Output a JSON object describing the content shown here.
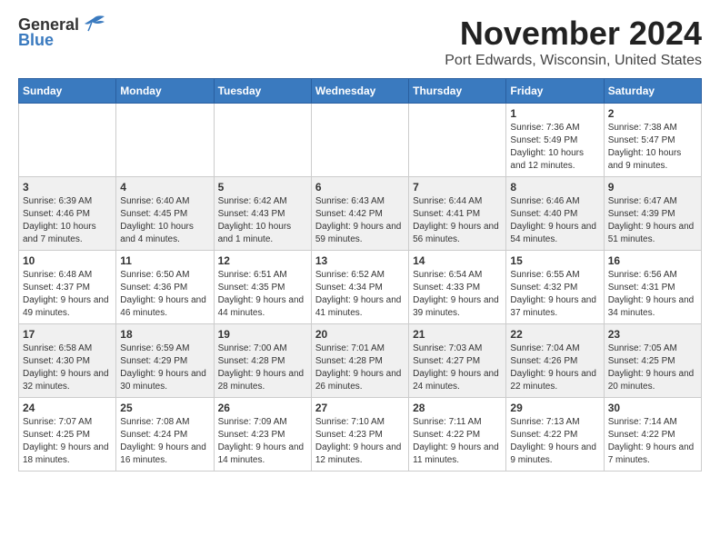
{
  "logo": {
    "general": "General",
    "blue": "Blue"
  },
  "title": "November 2024",
  "location": "Port Edwards, Wisconsin, United States",
  "days_of_week": [
    "Sunday",
    "Monday",
    "Tuesday",
    "Wednesday",
    "Thursday",
    "Friday",
    "Saturday"
  ],
  "weeks": [
    [
      {
        "day": "",
        "info": ""
      },
      {
        "day": "",
        "info": ""
      },
      {
        "day": "",
        "info": ""
      },
      {
        "day": "",
        "info": ""
      },
      {
        "day": "",
        "info": ""
      },
      {
        "day": "1",
        "info": "Sunrise: 7:36 AM\nSunset: 5:49 PM\nDaylight: 10 hours and 12 minutes."
      },
      {
        "day": "2",
        "info": "Sunrise: 7:38 AM\nSunset: 5:47 PM\nDaylight: 10 hours and 9 minutes."
      }
    ],
    [
      {
        "day": "3",
        "info": "Sunrise: 6:39 AM\nSunset: 4:46 PM\nDaylight: 10 hours and 7 minutes."
      },
      {
        "day": "4",
        "info": "Sunrise: 6:40 AM\nSunset: 4:45 PM\nDaylight: 10 hours and 4 minutes."
      },
      {
        "day": "5",
        "info": "Sunrise: 6:42 AM\nSunset: 4:43 PM\nDaylight: 10 hours and 1 minute."
      },
      {
        "day": "6",
        "info": "Sunrise: 6:43 AM\nSunset: 4:42 PM\nDaylight: 9 hours and 59 minutes."
      },
      {
        "day": "7",
        "info": "Sunrise: 6:44 AM\nSunset: 4:41 PM\nDaylight: 9 hours and 56 minutes."
      },
      {
        "day": "8",
        "info": "Sunrise: 6:46 AM\nSunset: 4:40 PM\nDaylight: 9 hours and 54 minutes."
      },
      {
        "day": "9",
        "info": "Sunrise: 6:47 AM\nSunset: 4:39 PM\nDaylight: 9 hours and 51 minutes."
      }
    ],
    [
      {
        "day": "10",
        "info": "Sunrise: 6:48 AM\nSunset: 4:37 PM\nDaylight: 9 hours and 49 minutes."
      },
      {
        "day": "11",
        "info": "Sunrise: 6:50 AM\nSunset: 4:36 PM\nDaylight: 9 hours and 46 minutes."
      },
      {
        "day": "12",
        "info": "Sunrise: 6:51 AM\nSunset: 4:35 PM\nDaylight: 9 hours and 44 minutes."
      },
      {
        "day": "13",
        "info": "Sunrise: 6:52 AM\nSunset: 4:34 PM\nDaylight: 9 hours and 41 minutes."
      },
      {
        "day": "14",
        "info": "Sunrise: 6:54 AM\nSunset: 4:33 PM\nDaylight: 9 hours and 39 minutes."
      },
      {
        "day": "15",
        "info": "Sunrise: 6:55 AM\nSunset: 4:32 PM\nDaylight: 9 hours and 37 minutes."
      },
      {
        "day": "16",
        "info": "Sunrise: 6:56 AM\nSunset: 4:31 PM\nDaylight: 9 hours and 34 minutes."
      }
    ],
    [
      {
        "day": "17",
        "info": "Sunrise: 6:58 AM\nSunset: 4:30 PM\nDaylight: 9 hours and 32 minutes."
      },
      {
        "day": "18",
        "info": "Sunrise: 6:59 AM\nSunset: 4:29 PM\nDaylight: 9 hours and 30 minutes."
      },
      {
        "day": "19",
        "info": "Sunrise: 7:00 AM\nSunset: 4:28 PM\nDaylight: 9 hours and 28 minutes."
      },
      {
        "day": "20",
        "info": "Sunrise: 7:01 AM\nSunset: 4:28 PM\nDaylight: 9 hours and 26 minutes."
      },
      {
        "day": "21",
        "info": "Sunrise: 7:03 AM\nSunset: 4:27 PM\nDaylight: 9 hours and 24 minutes."
      },
      {
        "day": "22",
        "info": "Sunrise: 7:04 AM\nSunset: 4:26 PM\nDaylight: 9 hours and 22 minutes."
      },
      {
        "day": "23",
        "info": "Sunrise: 7:05 AM\nSunset: 4:25 PM\nDaylight: 9 hours and 20 minutes."
      }
    ],
    [
      {
        "day": "24",
        "info": "Sunrise: 7:07 AM\nSunset: 4:25 PM\nDaylight: 9 hours and 18 minutes."
      },
      {
        "day": "25",
        "info": "Sunrise: 7:08 AM\nSunset: 4:24 PM\nDaylight: 9 hours and 16 minutes."
      },
      {
        "day": "26",
        "info": "Sunrise: 7:09 AM\nSunset: 4:23 PM\nDaylight: 9 hours and 14 minutes."
      },
      {
        "day": "27",
        "info": "Sunrise: 7:10 AM\nSunset: 4:23 PM\nDaylight: 9 hours and 12 minutes."
      },
      {
        "day": "28",
        "info": "Sunrise: 7:11 AM\nSunset: 4:22 PM\nDaylight: 9 hours and 11 minutes."
      },
      {
        "day": "29",
        "info": "Sunrise: 7:13 AM\nSunset: 4:22 PM\nDaylight: 9 hours and 9 minutes."
      },
      {
        "day": "30",
        "info": "Sunrise: 7:14 AM\nSunset: 4:22 PM\nDaylight: 9 hours and 7 minutes."
      }
    ]
  ]
}
